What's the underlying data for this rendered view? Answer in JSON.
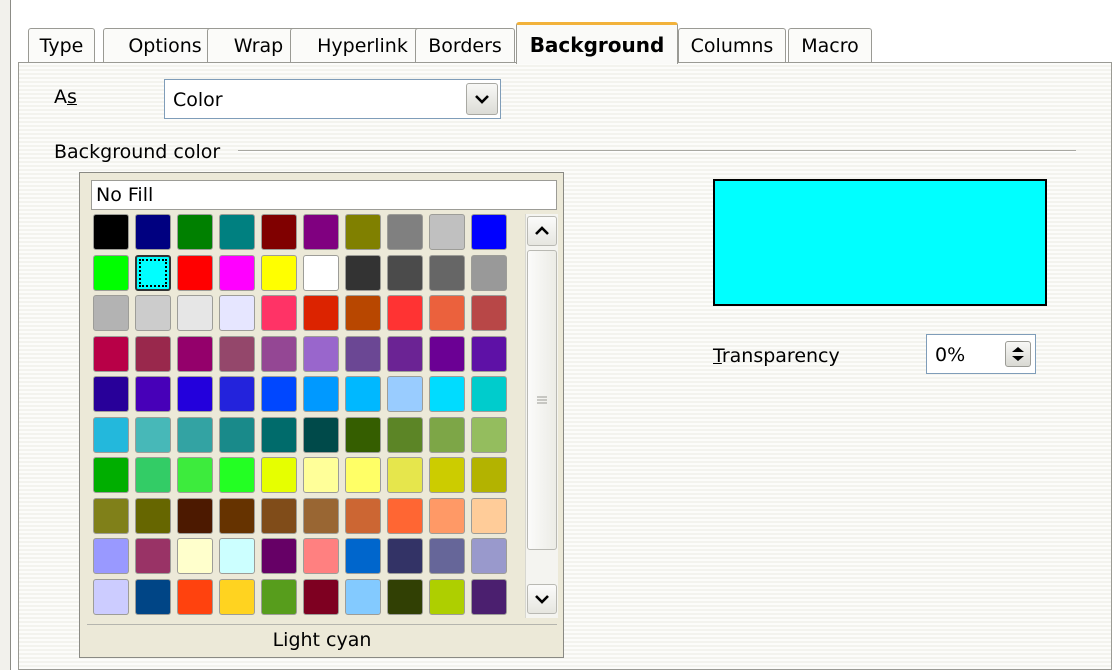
{
  "tabs": [
    {
      "label": "Type"
    },
    {
      "label": "Options"
    },
    {
      "label": "Wrap"
    },
    {
      "label": "Hyperlink"
    },
    {
      "label": "Borders"
    },
    {
      "label": "Background",
      "active": true
    },
    {
      "label": "Columns"
    },
    {
      "label": "Macro"
    }
  ],
  "as_field": {
    "label_prefix": "A",
    "label_accel": "s",
    "value": "Color"
  },
  "section_label": "Background color",
  "palette": {
    "no_fill": "No Fill",
    "selected_name": "Light cyan",
    "selected_index": 11,
    "colors": [
      "#000000",
      "#000080",
      "#008000",
      "#008080",
      "#800000",
      "#800080",
      "#808000",
      "#808080",
      "#c0c0c0",
      "#0000ff",
      "#00ff00",
      "#00ffff",
      "#ff0000",
      "#ff00ff",
      "#ffff00",
      "#ffffff",
      "#333333",
      "#4b4b4b",
      "#666666",
      "#999999",
      "#b3b3b3",
      "#cccccc",
      "#e6e6e6",
      "#e6e6ff",
      "#ff3366",
      "#dc2300",
      "#b84700",
      "#ff3333",
      "#eb613d",
      "#b84747",
      "#b80047",
      "#99284c",
      "#94006b",
      "#94476b",
      "#944794",
      "#9966cc",
      "#6b4794",
      "#6b2394",
      "#6b0094",
      "#5e11a6",
      "#280099",
      "#4700b8",
      "#2300dc",
      "#2323dc",
      "#0047ff",
      "#0099ff",
      "#00b8ff",
      "#99ccff",
      "#00dcff",
      "#00cccc",
      "#23b8dc",
      "#47b8b8",
      "#33a3a3",
      "#198a8a",
      "#006b6b",
      "#004a4a",
      "#355e00",
      "#5c8526",
      "#7da647",
      "#94bd5e",
      "#00ae00",
      "#33cc66",
      "#3deb3d",
      "#23ff23",
      "#e6ff00",
      "#ffff99",
      "#ffff66",
      "#e6e64c",
      "#cccc00",
      "#b3b300",
      "#808019",
      "#666600",
      "#4c1900",
      "#663300",
      "#804c19",
      "#996633",
      "#cc6633",
      "#ff6633",
      "#ff9966",
      "#ffcc99",
      "#9999ff",
      "#993366",
      "#ffffcc",
      "#ccffff",
      "#660066",
      "#ff8080",
      "#0066cc",
      "#333366",
      "#666699",
      "#9999cc",
      "#ccccff",
      "#004586",
      "#ff420e",
      "#ffd320",
      "#579d1c",
      "#7e0021",
      "#83caff",
      "#314004",
      "#aecf00",
      "#4b1f6f"
    ]
  },
  "preview_color": "#00ffff",
  "transparency": {
    "label_accel": "T",
    "label_rest": "ransparency",
    "value": "0%"
  }
}
